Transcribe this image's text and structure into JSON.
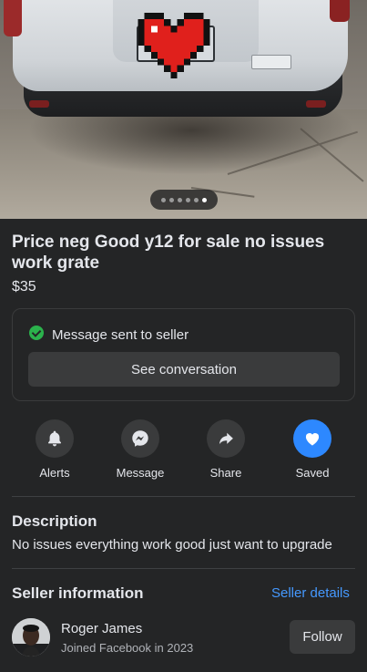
{
  "listing": {
    "title": "Price neg Good y12 for sale no issues work grate",
    "price": "$35",
    "photo_count": 6,
    "active_photo_index": 5
  },
  "message_card": {
    "status_text": "Message sent to seller",
    "button_label": "See conversation"
  },
  "actions": [
    {
      "label": "Alerts",
      "icon": "bell-icon"
    },
    {
      "label": "Message",
      "icon": "messenger-icon"
    },
    {
      "label": "Share",
      "icon": "share-icon"
    },
    {
      "label": "Saved",
      "icon": "heart-icon"
    }
  ],
  "description": {
    "heading": "Description",
    "text": "No issues everything work good just want to upgrade"
  },
  "seller": {
    "heading": "Seller information",
    "details_link": "Seller details",
    "name": "Roger James",
    "joined": "Joined Facebook in 2023",
    "follow_label": "Follow"
  },
  "colors": {
    "background": "#242526",
    "accent": "#2d88ff",
    "link": "#4599ff",
    "success": "#2bb24c",
    "heart_cover": "#e0201c"
  }
}
